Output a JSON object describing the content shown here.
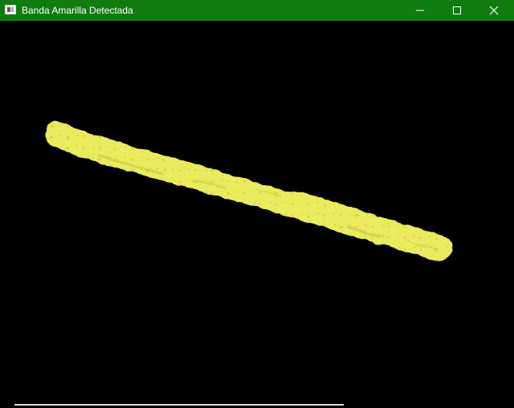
{
  "window": {
    "title": "Banda Amarilla Detectada",
    "title_bar_color": "#107c10",
    "icons": {
      "app": "app-window-icon",
      "minimize": "minimize-icon",
      "maximize": "maximize-icon",
      "close": "close-icon"
    }
  },
  "image": {
    "background_color": "#000000",
    "detected_band_color": "#e8e85a",
    "description_visible": false
  }
}
